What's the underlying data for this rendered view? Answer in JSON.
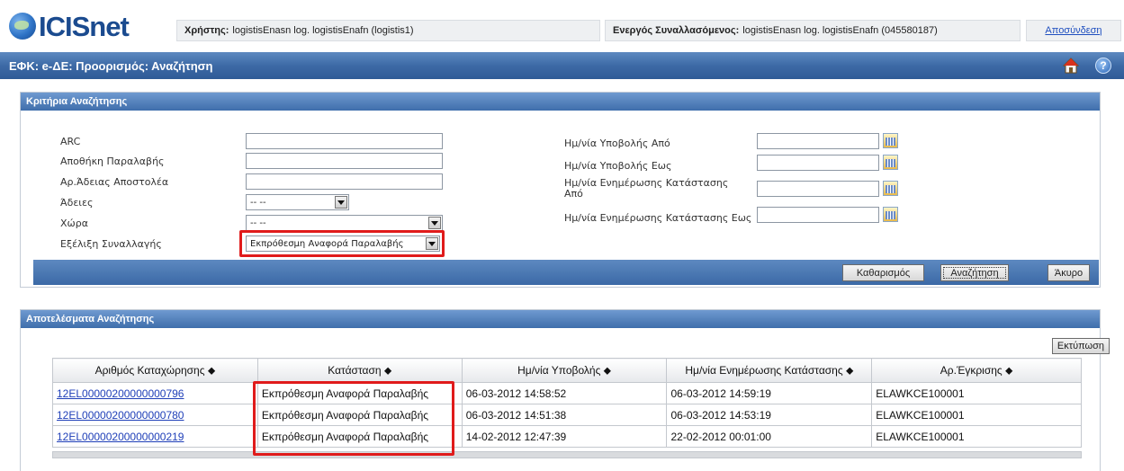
{
  "header": {
    "logo_text": "ICISnet",
    "user_label": "Χρήστης:",
    "user_value": "logistisEnasn log. logistisEnafn (logistis1)",
    "trader_label": "Ενεργός Συναλλασόμενος:",
    "trader_value": "logistisEnasn log. logistisEnafn (045580187)",
    "logout": "Αποσύνδεση"
  },
  "titlebar": {
    "title": "ΕΦΚ: e-ΔΕ: Προορισμός: Αναζήτηση",
    "help_symbol": "?"
  },
  "criteria": {
    "header": "Κριτήρια Αναζήτησης",
    "arc_label": "ARC",
    "warehouse_label": "Αποθήκη Παραλαβής",
    "sender_permit_label": "Αρ.Άδειας Αποστολέα",
    "permits_label": "Άδειες",
    "permits_value": "-- --",
    "country_label": "Χώρα",
    "country_value": "-- --",
    "progress_label": "Εξέλιξη Συναλλαγής",
    "progress_value": "Εκπρόθεσμη Αναφορά Παραλαβής",
    "submit_from_label": "Ημ/νία Υποβολής Από",
    "submit_to_label": "Ημ/νία Υποβολής Εως",
    "status_from_label_1": "Ημ/νία Ενημέρωσης Κατάστασης",
    "status_from_label_2": "Από",
    "status_to_label": "Ημ/νία Ενημέρωσης Κατάστασης Εως",
    "clear_button": "Καθαρισμός",
    "search_button": "Αναζήτηση",
    "cancel_button": "Άκυρο"
  },
  "results": {
    "header": "Αποτελέσματα Αναζήτησης",
    "print_button": "Εκτύπωση",
    "columns": [
      "Αριθμός Καταχώρησης ⬥",
      "Κατάσταση ⬥",
      "Ημ/νία Υποβολής ⬥",
      "Ημ/νία Ενημέρωσης Κατάστασης ⬥",
      "Αρ.Έγκρισης ⬥"
    ],
    "rows": [
      [
        "12EL00000200000000796",
        "Εκπρόθεσμη Αναφορά Παραλαβής",
        "06-03-2012 14:58:52",
        "06-03-2012 14:59:19",
        "ELAWKCE100001"
      ],
      [
        "12EL00000200000000780",
        "Εκπρόθεσμη Αναφορά Παραλαβής",
        "06-03-2012 14:51:38",
        "06-03-2012 14:53:19",
        "ELAWKCE100001"
      ],
      [
        "12EL00000200000000219",
        "Εκπρόθεσμη Αναφορά Παραλαβής",
        "14-02-2012 12:47:39",
        "22-02-2012 00:01:00",
        "ELAWKCE100001"
      ]
    ]
  },
  "colors": {
    "header_blue": "#3d6aa6",
    "highlight_red": "#e01b1b",
    "link_blue": "#1f3fb8"
  }
}
